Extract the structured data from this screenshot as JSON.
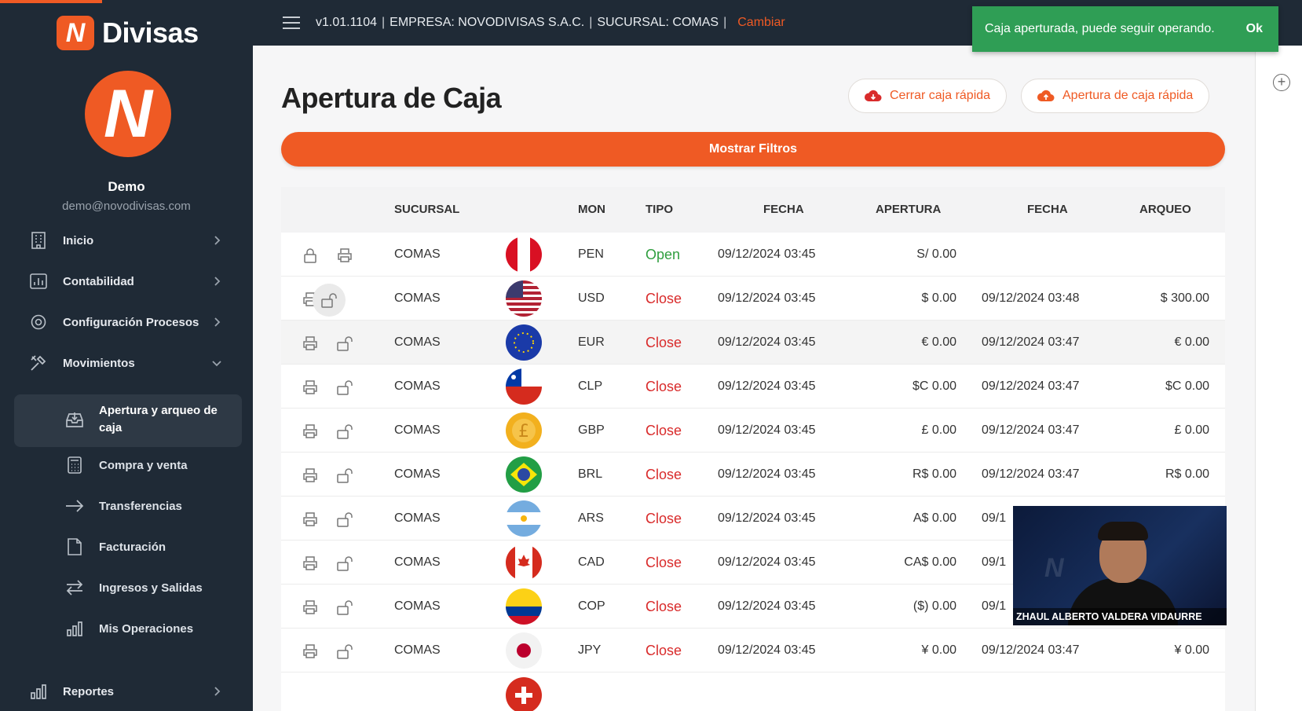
{
  "brand": {
    "name": "Divisas",
    "logo_letter": "N"
  },
  "user": {
    "name": "Demo",
    "email": "demo@novodivisas.com",
    "avatar_letter": "N"
  },
  "sidebar": {
    "items": [
      {
        "label": "Inicio",
        "icon": "building-icon"
      },
      {
        "label": "Contabilidad",
        "icon": "chart-board-icon"
      },
      {
        "label": "Configuración Procesos",
        "icon": "gear-icon"
      },
      {
        "label": "Movimientos",
        "icon": "tools-icon"
      }
    ],
    "sub_items": [
      {
        "label": "Apertura y arqueo de caja",
        "icon": "inbox-download-icon"
      },
      {
        "label": "Compra y venta",
        "icon": "calculator-icon"
      },
      {
        "label": "Transferencias",
        "icon": "arrow-right-icon"
      },
      {
        "label": "Facturación",
        "icon": "document-icon"
      },
      {
        "label": "Ingresos y Salidas",
        "icon": "swap-arrows-icon"
      },
      {
        "label": "Mis Operaciones",
        "icon": "bar-chart-icon"
      }
    ],
    "footer_item": {
      "label": "Reportes",
      "icon": "bar-chart-icon"
    }
  },
  "topbar": {
    "version": "v1.01.1104",
    "empresa": "EMPRESA: NOVODIVISAS S.A.C.",
    "sucursal": "SUCURSAL: COMAS",
    "sep": "|",
    "cambiar": "Cambiar"
  },
  "toast": {
    "message": "Caja aperturada, puede seguir operando.",
    "ok": "Ok"
  },
  "page": {
    "title": "Apertura de Caja",
    "btn_cerrar": "Cerrar caja rápida",
    "btn_apertura": "Apertura de caja rápida",
    "btn_filtros": "Mostrar Filtros"
  },
  "table": {
    "headers": {
      "sucursal": "SUCURSAL",
      "mon": "MON",
      "tipo": "TIPO",
      "fecha1": "FECHA",
      "apertura": "APERTURA",
      "fecha2": "FECHA",
      "arqueo": "ARQUEO"
    },
    "rows": [
      {
        "sucursal": "COMAS",
        "mon": "PEN",
        "tipo": "Open",
        "fecha": "09/12/2024 03:45",
        "apertura": "S/ 0.00",
        "fecha_cierre": "",
        "arqueo": ""
      },
      {
        "sucursal": "COMAS",
        "mon": "USD",
        "tipo": "Close",
        "fecha": "09/12/2024 03:45",
        "apertura": "$ 0.00",
        "fecha_cierre": "09/12/2024 03:48",
        "arqueo": "$ 300.00"
      },
      {
        "sucursal": "COMAS",
        "mon": "EUR",
        "tipo": "Close",
        "fecha": "09/12/2024 03:45",
        "apertura": "€ 0.00",
        "fecha_cierre": "09/12/2024 03:47",
        "arqueo": "€ 0.00"
      },
      {
        "sucursal": "COMAS",
        "mon": "CLP",
        "tipo": "Close",
        "fecha": "09/12/2024 03:45",
        "apertura": "$C 0.00",
        "fecha_cierre": "09/12/2024 03:47",
        "arqueo": "$C 0.00"
      },
      {
        "sucursal": "COMAS",
        "mon": "GBP",
        "tipo": "Close",
        "fecha": "09/12/2024 03:45",
        "apertura": "£ 0.00",
        "fecha_cierre": "09/12/2024 03:47",
        "arqueo": "£ 0.00"
      },
      {
        "sucursal": "COMAS",
        "mon": "BRL",
        "tipo": "Close",
        "fecha": "09/12/2024 03:45",
        "apertura": "R$ 0.00",
        "fecha_cierre": "09/12/2024 03:47",
        "arqueo": "R$ 0.00"
      },
      {
        "sucursal": "COMAS",
        "mon": "ARS",
        "tipo": "Close",
        "fecha": "09/12/2024 03:45",
        "apertura": "A$ 0.00",
        "fecha_cierre": "09/1",
        "arqueo": ""
      },
      {
        "sucursal": "COMAS",
        "mon": "CAD",
        "tipo": "Close",
        "fecha": "09/12/2024 03:45",
        "apertura": "CA$ 0.00",
        "fecha_cierre": "09/1",
        "arqueo": ""
      },
      {
        "sucursal": "COMAS",
        "mon": "COP",
        "tipo": "Close",
        "fecha": "09/12/2024 03:45",
        "apertura": "($) 0.00",
        "fecha_cierre": "09/1",
        "arqueo": ""
      },
      {
        "sucursal": "COMAS",
        "mon": "JPY",
        "tipo": "Close",
        "fecha": "09/12/2024 03:45",
        "apertura": "¥ 0.00",
        "fecha_cierre": "09/12/2024 03:47",
        "arqueo": "¥ 0.00"
      }
    ]
  },
  "video": {
    "caption": "ZHAUL ALBERTO VALDERA VIDAURRE"
  },
  "colors": {
    "accent": "#ef5a24",
    "sidebar": "#1f2a36",
    "open": "#2f9e3e",
    "close": "#d92b2b",
    "toast": "#2f9e55"
  }
}
